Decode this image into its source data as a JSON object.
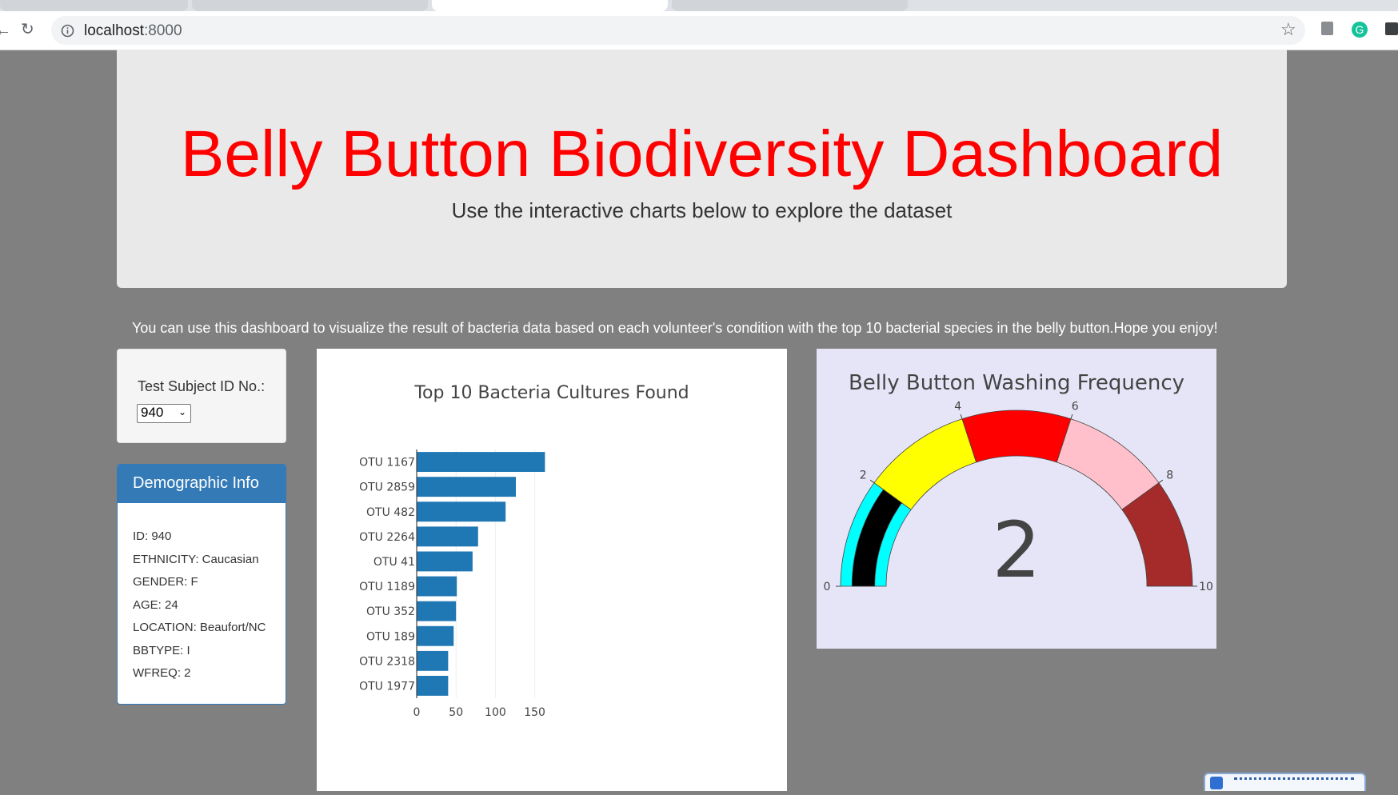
{
  "browser": {
    "url_host": "localhost",
    "url_port": ":8000"
  },
  "header": {
    "title": "Belly Button Biodiversity Dashboard",
    "subtitle": "Use the interactive charts below to explore the dataset"
  },
  "intro_text": "You can use this dashboard to visualize the result of bacteria data based on each volunteer's condition with the top 10 bacterial species in the belly button.Hope you enjoy!",
  "selector": {
    "label": "Test Subject ID No.:",
    "selected": "940"
  },
  "demographics": {
    "heading": "Demographic Info",
    "items": [
      "ID: 940",
      "ETHNICITY: Caucasian",
      "GENDER: F",
      "AGE: 24",
      "LOCATION: Beaufort/NC",
      "BBTYPE: I",
      "WFREQ: 2"
    ]
  },
  "colors": {
    "title_red": "#ff0000",
    "bar_blue": "#1f77b4",
    "panel_blue": "#337ab7",
    "page_bg": "#808080"
  },
  "chart_data": [
    {
      "type": "bar",
      "orientation": "horizontal",
      "title": "Top 10 Bacteria Cultures Found",
      "categories": [
        "OTU 1167",
        "OTU 2859",
        "OTU 482",
        "OTU 2264",
        "OTU 41",
        "OTU 1189",
        "OTU 352",
        "OTU 189",
        "OTU 2318",
        "OTU 1977"
      ],
      "values": [
        163,
        126,
        113,
        78,
        71,
        51,
        50,
        47,
        40,
        40
      ],
      "xlim": [
        0,
        170
      ],
      "xticks": [
        0,
        50,
        100,
        150
      ],
      "grid": true,
      "color": "#1f77b4"
    },
    {
      "type": "gauge",
      "title": "Belly Button Washing Frequency",
      "value": 2,
      "range": [
        0,
        10
      ],
      "ticks": [
        0,
        2,
        4,
        6,
        8,
        10
      ],
      "bar_color": "#000000",
      "steps": [
        {
          "range": [
            0,
            2
          ],
          "color": "cyan"
        },
        {
          "range": [
            2,
            4
          ],
          "color": "yellow"
        },
        {
          "range": [
            4,
            6
          ],
          "color": "red"
        },
        {
          "range": [
            6,
            8
          ],
          "color": "pink"
        },
        {
          "range": [
            8,
            10
          ],
          "color": "brown"
        }
      ]
    }
  ]
}
